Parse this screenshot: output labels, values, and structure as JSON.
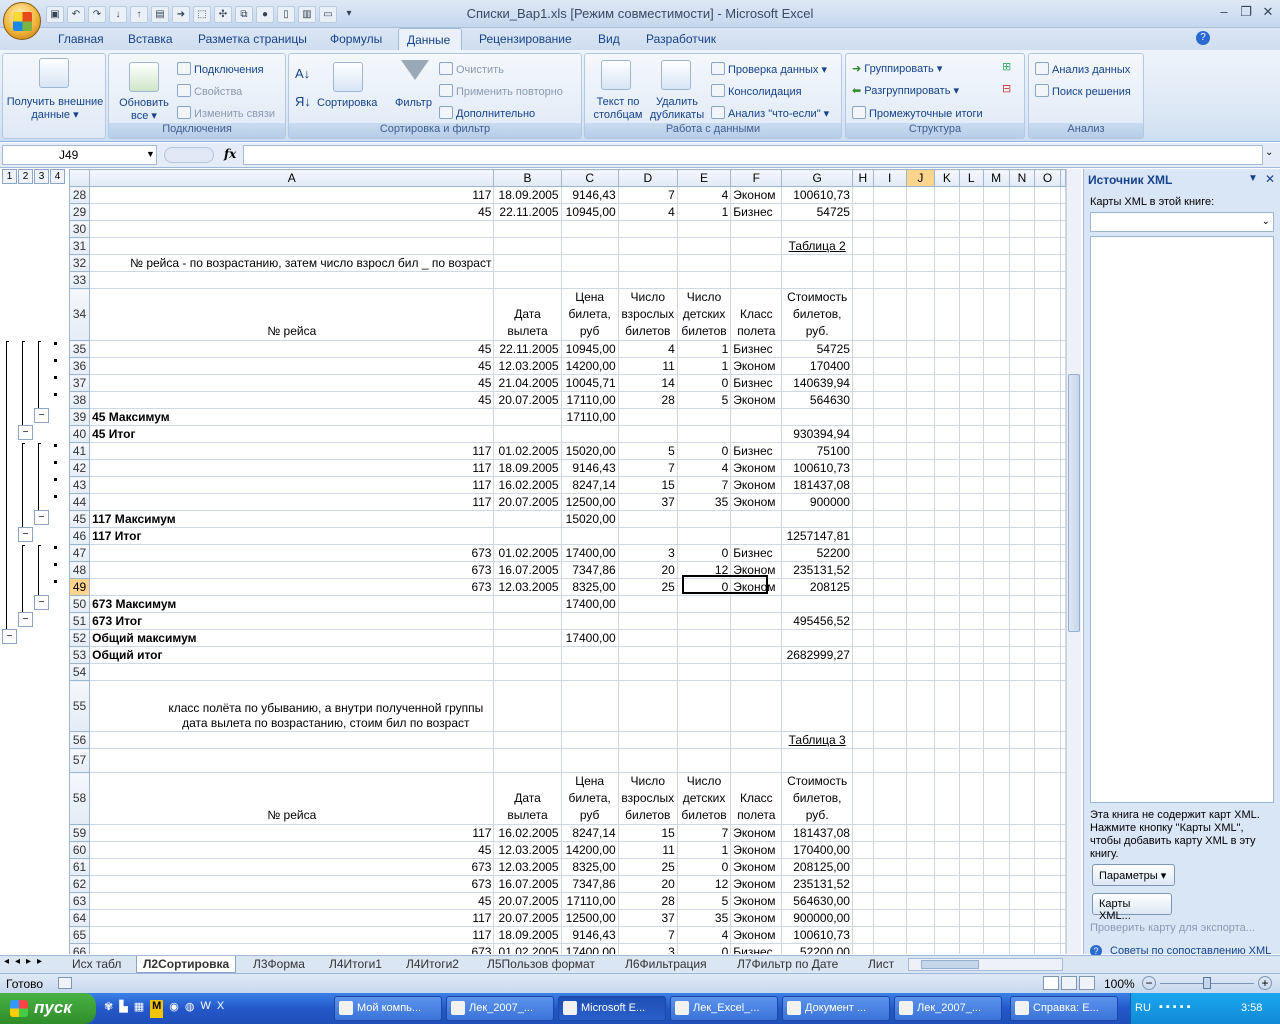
{
  "window": {
    "title": "Списки_Вар1.xls  [Режим совместимости] - Microsoft Excel",
    "minimize": "–",
    "restore": "❐",
    "close": "✕"
  },
  "ribbon_tabs": [
    "Главная",
    "Вставка",
    "Разметка страницы",
    "Формулы",
    "Данные",
    "Рецензирование",
    "Вид",
    "Разработчик"
  ],
  "ribbon": {
    "g1": {
      "label": "",
      "btn1": "Получить внешние данные ▾"
    },
    "g2": {
      "label": "Подключения",
      "refresh": "Обновить все ▾",
      "connections": "Подключения",
      "properties": "Свойства",
      "edit_links": "Изменить связи"
    },
    "g3": {
      "label": "Сортировка и фильтр",
      "sort": "Сортировка",
      "filter": "Фильтр",
      "clear": "Очистить",
      "reapply": "Применить повторно",
      "advanced": "Дополнительно"
    },
    "g4": {
      "label": "Работа с данными",
      "text_to_cols": "Текст по столбцам",
      "remove_dup": "Удалить дубликаты",
      "validation": "Проверка данных ▾",
      "consolidate": "Консолидация",
      "whatif": "Анализ \"что-если\" ▾"
    },
    "g5": {
      "label": "Структура",
      "group": "Группировать ▾",
      "ungroup": "Разгруппировать ▾",
      "subtotals": "Промежуточные итоги"
    },
    "g6": {
      "label": "Анализ",
      "analysis": "Анализ данных",
      "solver": "Поиск решения"
    }
  },
  "formula": {
    "namebox": "J49",
    "fx": "fx",
    "value": ""
  },
  "outline_levels": [
    "1",
    "2",
    "3",
    "4"
  ],
  "columns": [
    "A",
    "B",
    "C",
    "D",
    "E",
    "F",
    "G",
    "H",
    "I",
    "J",
    "K",
    "L",
    "M",
    "N",
    "O"
  ],
  "rows": [
    {
      "n": "28",
      "cells": [
        "117",
        "18.09.2005",
        "9146,43",
        "7",
        "4",
        "Эконом",
        "100610,73"
      ]
    },
    {
      "n": "29",
      "cells": [
        "45",
        "22.11.2005",
        "10945,00",
        "4",
        "1",
        "Бизнес",
        "54725"
      ]
    },
    {
      "n": "30",
      "cells": [
        "",
        "",
        "",
        "",
        "",
        "",
        ""
      ]
    },
    {
      "n": "31",
      "cells": [
        "",
        "",
        "",
        "",
        "",
        "",
        "Таблица 2"
      ]
    },
    {
      "n": "32",
      "cells": [
        "№ рейса - по возрастанию, затем число взросл бил _ по возраст",
        "",
        "",
        "",
        "",
        "",
        ""
      ]
    },
    {
      "n": "33",
      "cells": [
        "",
        "",
        "",
        "",
        "",
        "",
        ""
      ]
    },
    {
      "n": "34",
      "cells": [
        "№ рейса",
        "Дата вылета",
        "Цена билета, руб",
        "Число взрослых билетов",
        "Число детских билетов",
        "Класс полета",
        "Стоимость билетов, руб."
      ]
    },
    {
      "n": "35",
      "cells": [
        "45",
        "22.11.2005",
        "10945,00",
        "4",
        "1",
        "Бизнес",
        "54725"
      ]
    },
    {
      "n": "36",
      "cells": [
        "45",
        "12.03.2005",
        "14200,00",
        "11",
        "1",
        "Эконом",
        "170400"
      ]
    },
    {
      "n": "37",
      "cells": [
        "45",
        "21.04.2005",
        "10045,71",
        "14",
        "0",
        "Бизнес",
        "140639,94"
      ]
    },
    {
      "n": "38",
      "cells": [
        "45",
        "20.07.2005",
        "17110,00",
        "28",
        "5",
        "Эконом",
        "564630"
      ]
    },
    {
      "n": "39",
      "cells": [
        "45 Максимум",
        "",
        "17110,00",
        "",
        "",
        "",
        ""
      ]
    },
    {
      "n": "40",
      "cells": [
        "45 Итог",
        "",
        "",
        "",
        "",
        "",
        "930394,94"
      ]
    },
    {
      "n": "41",
      "cells": [
        "117",
        "01.02.2005",
        "15020,00",
        "5",
        "0",
        "Бизнес",
        "75100"
      ]
    },
    {
      "n": "42",
      "cells": [
        "117",
        "18.09.2005",
        "9146,43",
        "7",
        "4",
        "Эконом",
        "100610,73"
      ]
    },
    {
      "n": "43",
      "cells": [
        "117",
        "16.02.2005",
        "8247,14",
        "15",
        "7",
        "Эконом",
        "181437,08"
      ]
    },
    {
      "n": "44",
      "cells": [
        "117",
        "20.07.2005",
        "12500,00",
        "37",
        "35",
        "Эконом",
        "900000"
      ]
    },
    {
      "n": "45",
      "cells": [
        "117 Максимум",
        "",
        "15020,00",
        "",
        "",
        "",
        ""
      ]
    },
    {
      "n": "46",
      "cells": [
        "117 Итог",
        "",
        "",
        "",
        "",
        "",
        "1257147,81"
      ]
    },
    {
      "n": "47",
      "cells": [
        "673",
        "01.02.2005",
        "17400,00",
        "3",
        "0",
        "Бизнес",
        "52200"
      ]
    },
    {
      "n": "48",
      "cells": [
        "673",
        "16.07.2005",
        "7347,86",
        "20",
        "12",
        "Эконом",
        "235131,52"
      ]
    },
    {
      "n": "49",
      "cells": [
        "673",
        "12.03.2005",
        "8325,00",
        "25",
        "0",
        "Эконом",
        "208125"
      ]
    },
    {
      "n": "50",
      "cells": [
        "673 Максимум",
        "",
        "17400,00",
        "",
        "",
        "",
        ""
      ]
    },
    {
      "n": "51",
      "cells": [
        "673 Итог",
        "",
        "",
        "",
        "",
        "",
        "495456,52"
      ]
    },
    {
      "n": "52",
      "cells": [
        "Общий максимум",
        "",
        "17400,00",
        "",
        "",
        "",
        ""
      ]
    },
    {
      "n": "53",
      "cells": [
        "Общий итог",
        "",
        "",
        "",
        "",
        "",
        "2682999,27"
      ]
    },
    {
      "n": "54",
      "cells": [
        "",
        "",
        "",
        "",
        "",
        "",
        ""
      ]
    },
    {
      "n": "55",
      "cells": [
        "класс полёта по убыванию, а внутри полученной группы\nдата вылета по возрастанию, стоим бил по возраст",
        "",
        "",
        "",
        "",
        "",
        ""
      ]
    },
    {
      "n": "56",
      "cells": [
        "",
        "",
        "",
        "",
        "",
        "",
        "Таблица 3"
      ]
    },
    {
      "n": "57",
      "cells": [
        "",
        "",
        "",
        "",
        "",
        "",
        ""
      ]
    },
    {
      "n": "58",
      "cells": [
        "№ рейса",
        "Дата вылета",
        "Цена билета, руб",
        "Число взрослых билетов",
        "Число детских билетов",
        "Класс полета",
        "Стоимость билетов, руб."
      ]
    },
    {
      "n": "59",
      "cells": [
        "117",
        "16.02.2005",
        "8247,14",
        "15",
        "7",
        "Эконом",
        "181437,08"
      ]
    },
    {
      "n": "60",
      "cells": [
        "45",
        "12.03.2005",
        "14200,00",
        "11",
        "1",
        "Эконом",
        "170400,00"
      ]
    },
    {
      "n": "61",
      "cells": [
        "673",
        "12.03.2005",
        "8325,00",
        "25",
        "0",
        "Эконом",
        "208125,00"
      ]
    },
    {
      "n": "62",
      "cells": [
        "673",
        "16.07.2005",
        "7347,86",
        "20",
        "12",
        "Эконом",
        "235131,52"
      ]
    },
    {
      "n": "63",
      "cells": [
        "45",
        "20.07.2005",
        "17110,00",
        "28",
        "5",
        "Эконом",
        "564630,00"
      ]
    },
    {
      "n": "64",
      "cells": [
        "117",
        "20.07.2005",
        "12500,00",
        "37",
        "35",
        "Эконом",
        "900000,00"
      ]
    },
    {
      "n": "65",
      "cells": [
        "117",
        "18.09.2005",
        "9146,43",
        "7",
        "4",
        "Эконом",
        "100610,73"
      ]
    },
    {
      "n": "66",
      "cells": [
        "673",
        "01.02.2005",
        "17400,00",
        "3",
        "0",
        "Бизнес",
        "52200,00"
      ]
    }
  ],
  "xml_pane": {
    "title": "Источник XML",
    "maps_label": "Карты XML в этой книге:",
    "info": "Эта книга не содержит карт XML. Нажмите кнопку \"Карты XML\", чтобы добавить карту XML в эту книгу.",
    "params_btn": "Параметры ▾",
    "maps_btn": "Карты XML...",
    "verify": "Проверить карту для экспорта...",
    "tips": "Советы по сопоставлению XML"
  },
  "sheet_tabs": [
    "Исх табл",
    "Л2Сортировка",
    "Л3Форма",
    "Л4Итоги1",
    "Л4Итоги2",
    "Л5Пользов формат",
    "Л6Фильтрация",
    "Л7Фильтр по Дате",
    "Лист"
  ],
  "status": {
    "ready": "Готово",
    "zoom": "100%"
  },
  "taskbar": {
    "start": "пуск",
    "tasks": [
      "Мой компь...",
      "Лек_2007_...",
      "Microsoft E...",
      "Лек_Excel_...",
      "Документ ...",
      "Лек_2007_...",
      "Справка: E..."
    ],
    "lang": "RU",
    "clock": "3:58"
  }
}
